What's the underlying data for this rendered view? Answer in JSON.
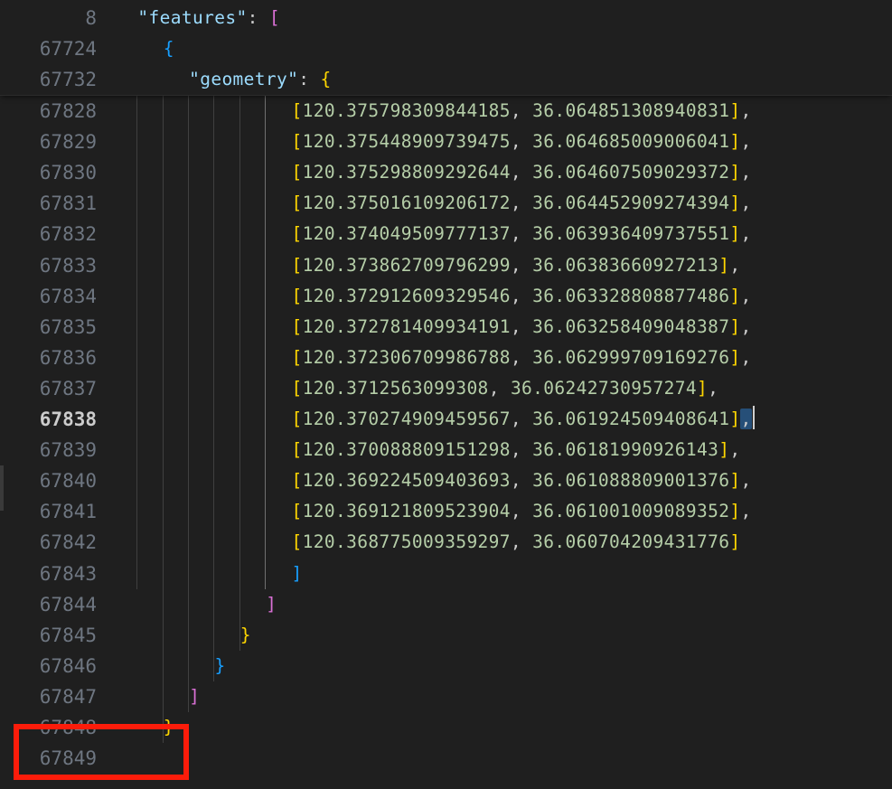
{
  "editor": {
    "theme_background": "#1f1f1f",
    "accent_annotation_color": "#fc1c0a",
    "selection_color": "#264f78",
    "sticky_lines": [
      {
        "number": "8",
        "indent": 1,
        "text": "\"features\": [",
        "kind": "key-open-bracket"
      },
      {
        "number": "67724",
        "indent": 2,
        "text": "{",
        "kind": "open-brace"
      },
      {
        "number": "67732",
        "indent": 3,
        "text": "\"geometry\": {",
        "kind": "key-open-brace"
      }
    ],
    "lines": [
      {
        "number": "67828",
        "lon": "120.375798309844185",
        "lat": "36.064851308940831",
        "trailing_comma": true,
        "active": false
      },
      {
        "number": "67829",
        "lon": "120.375448909739475",
        "lat": "36.064685009006041",
        "trailing_comma": true,
        "active": false
      },
      {
        "number": "67830",
        "lon": "120.375298809292644",
        "lat": "36.064607509029372",
        "trailing_comma": true,
        "active": false
      },
      {
        "number": "67831",
        "lon": "120.375016109206172",
        "lat": "36.064452909274394",
        "trailing_comma": true,
        "active": false
      },
      {
        "number": "67832",
        "lon": "120.374049509777137",
        "lat": "36.063936409737551",
        "trailing_comma": true,
        "active": false
      },
      {
        "number": "67833",
        "lon": "120.373862709796299",
        "lat": "36.06383660927213",
        "trailing_comma": true,
        "active": false
      },
      {
        "number": "67834",
        "lon": "120.372912609329546",
        "lat": "36.063328808877486",
        "trailing_comma": true,
        "active": false
      },
      {
        "number": "67835",
        "lon": "120.372781409934191",
        "lat": "36.063258409048387",
        "trailing_comma": true,
        "active": false
      },
      {
        "number": "67836",
        "lon": "120.372306709986788",
        "lat": "36.062999709169276",
        "trailing_comma": true,
        "active": false
      },
      {
        "number": "67837",
        "lon": "120.3712563099308",
        "lat": "36.06242730957274",
        "trailing_comma": true,
        "active": false
      },
      {
        "number": "67838",
        "lon": "120.370274909459567",
        "lat": "36.061924509408641",
        "trailing_comma": true,
        "active": true,
        "comma_selected": true,
        "caret_after": true
      },
      {
        "number": "67839",
        "lon": "120.370088809151298",
        "lat": "36.06181990926143",
        "trailing_comma": true,
        "active": false
      },
      {
        "number": "67840",
        "lon": "120.369224509403693",
        "lat": "36.061088809001376",
        "trailing_comma": true,
        "active": false
      },
      {
        "number": "67841",
        "lon": "120.369121809523904",
        "lat": "36.061001009089352",
        "trailing_comma": true,
        "active": false
      },
      {
        "number": "67842",
        "lon": "120.368775009359297",
        "lat": "36.060704209431776",
        "trailing_comma": false,
        "active": false
      }
    ],
    "closing_lines": [
      {
        "number": "67843",
        "indent": 7,
        "text": "]",
        "color": "#179fff"
      },
      {
        "number": "67844",
        "indent": 6,
        "text": "]",
        "color": "#da70d6"
      },
      {
        "number": "67845",
        "indent": 5,
        "text": "}",
        "color": "#ffd700"
      },
      {
        "number": "67846",
        "indent": 4,
        "text": "}",
        "color": "#179fff"
      },
      {
        "number": "67847",
        "indent": 3,
        "text": "]",
        "color": "#da70d6"
      },
      {
        "number": "67848",
        "indent": 2,
        "text": "}",
        "color": "#ffd700"
      },
      {
        "number": "67849",
        "indent": 0,
        "text": "",
        "color": "#cccccc"
      }
    ],
    "brackets": {
      "open": "[",
      "close": "]",
      "comma": ",",
      "space": " "
    }
  }
}
